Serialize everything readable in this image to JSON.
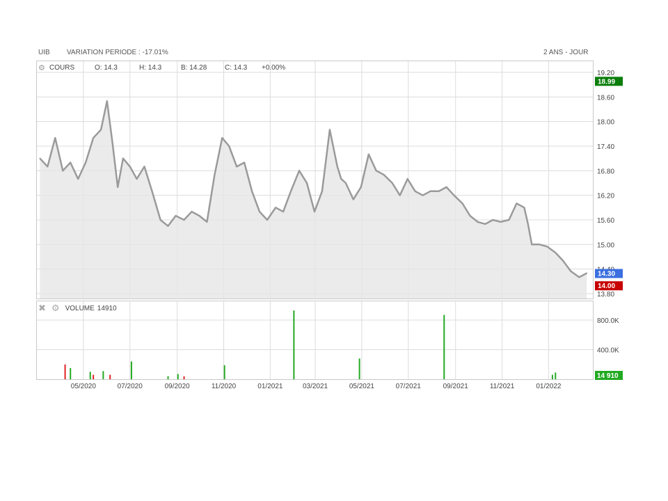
{
  "header": {
    "ticker": "UIB",
    "variation": "VARIATION PERIODE : -17.01%",
    "period": "2 ANS - JOUR"
  },
  "ohlc": {
    "label": "COURS",
    "open": "O: 14.3",
    "high": "H: 14.3",
    "low": "B: 14.28",
    "close": "C: 14.3",
    "change": "+0.00%"
  },
  "volume_panel": {
    "label": "VOLUME",
    "value": "14910"
  },
  "icons": {
    "settings": "gear-icon",
    "close": "close-icon"
  },
  "colors": {
    "price_line": "#9a9a9a",
    "area_fill": "#e6e6e6",
    "grid": "#dcdcdc",
    "up": "#22aa22",
    "down": "#dd2222",
    "badge_high": "#0a7d0a",
    "badge_current": "#3b6fe0",
    "badge_low": "#c80000",
    "badge_volume": "#22aa22"
  },
  "chart_data": [
    {
      "type": "line",
      "series": [
        {
          "name": "COURS"
        }
      ],
      "x": [
        "2020-03-05",
        "2020-03-15",
        "2020-03-25",
        "2020-04-04",
        "2020-04-14",
        "2020-04-24",
        "2020-05-04",
        "2020-05-14",
        "2020-05-24",
        "2020-06-01",
        "2020-06-08",
        "2020-06-15",
        "2020-06-22",
        "2020-07-01",
        "2020-07-10",
        "2020-07-20",
        "2020-07-30",
        "2020-08-10",
        "2020-08-20",
        "2020-08-30",
        "2020-09-10",
        "2020-09-20",
        "2020-09-30",
        "2020-10-10",
        "2020-10-20",
        "2020-10-30",
        "2020-11-08",
        "2020-11-18",
        "2020-11-28",
        "2020-12-08",
        "2020-12-18",
        "2020-12-28",
        "2021-01-08",
        "2021-01-18",
        "2021-01-28",
        "2021-02-08",
        "2021-02-18",
        "2021-02-28",
        "2021-03-10",
        "2021-03-20",
        "2021-03-30",
        "2021-04-04",
        "2021-04-10",
        "2021-04-20",
        "2021-04-30",
        "2021-05-10",
        "2021-05-20",
        "2021-05-30",
        "2021-06-10",
        "2021-06-20",
        "2021-06-30",
        "2021-07-10",
        "2021-07-20",
        "2021-07-30",
        "2021-08-10",
        "2021-08-20",
        "2021-08-30",
        "2021-09-10",
        "2021-09-20",
        "2021-09-30",
        "2021-10-10",
        "2021-10-20",
        "2021-10-30",
        "2021-11-10",
        "2021-11-20",
        "2021-11-30",
        "2021-12-05",
        "2021-12-10",
        "2021-12-20",
        "2021-12-30",
        "2022-01-10",
        "2022-01-20",
        "2022-01-30",
        "2022-02-10",
        "2022-02-20"
      ],
      "values": [
        17.1,
        16.9,
        17.6,
        16.8,
        17.0,
        16.6,
        17.0,
        17.6,
        17.8,
        18.5,
        17.5,
        16.4,
        17.1,
        16.9,
        16.6,
        16.9,
        16.3,
        15.6,
        15.45,
        15.7,
        15.6,
        15.8,
        15.7,
        15.55,
        16.7,
        17.6,
        17.4,
        16.9,
        17.0,
        16.3,
        15.8,
        15.6,
        15.9,
        15.8,
        16.3,
        16.8,
        16.5,
        15.8,
        16.3,
        17.8,
        16.9,
        16.6,
        16.5,
        16.1,
        16.4,
        17.2,
        16.8,
        16.7,
        16.5,
        16.2,
        16.6,
        16.3,
        16.2,
        16.3,
        16.3,
        16.4,
        16.2,
        16.0,
        15.7,
        15.55,
        15.5,
        15.6,
        15.55,
        15.6,
        16.0,
        15.9,
        15.5,
        15.0,
        15.0,
        14.95,
        14.8,
        14.6,
        14.35,
        14.2,
        14.3
      ],
      "ylim": [
        13.8,
        19.2
      ],
      "yticks": [
        "13.80",
        "14.40",
        "15.00",
        "15.60",
        "16.20",
        "16.80",
        "17.40",
        "18.00",
        "18.60",
        "19.20"
      ],
      "badges": {
        "high": "18.99",
        "current": "14.30",
        "low": "14.00"
      },
      "grid": true
    },
    {
      "type": "bar",
      "series": [
        {
          "name": "VOLUME"
        }
      ],
      "x": [
        "2020-04-07",
        "2020-04-14",
        "2020-05-10",
        "2020-05-14",
        "2020-05-27",
        "2020-06-05",
        "2020-07-03",
        "2020-08-20",
        "2020-09-02",
        "2020-09-10",
        "2020-11-02",
        "2021-02-01",
        "2021-04-28",
        "2021-08-17",
        "2022-01-06",
        "2022-01-10"
      ],
      "values": [
        200000,
        150000,
        100000,
        60000,
        110000,
        60000,
        240000,
        40000,
        70000,
        40000,
        190000,
        930000,
        280000,
        870000,
        60000,
        90000
      ],
      "ylim": [
        0,
        1000000
      ],
      "yticks": [
        "400.0K",
        "800.0K"
      ],
      "badge": "14 910",
      "grid": true
    },
    {
      "type": "table",
      "x_axis_ticks": [
        "05/2020",
        "07/2020",
        "09/2020",
        "11/2020",
        "01/2021",
        "03/2021",
        "05/2021",
        "07/2021",
        "09/2021",
        "11/2021",
        "01/2022"
      ]
    }
  ]
}
